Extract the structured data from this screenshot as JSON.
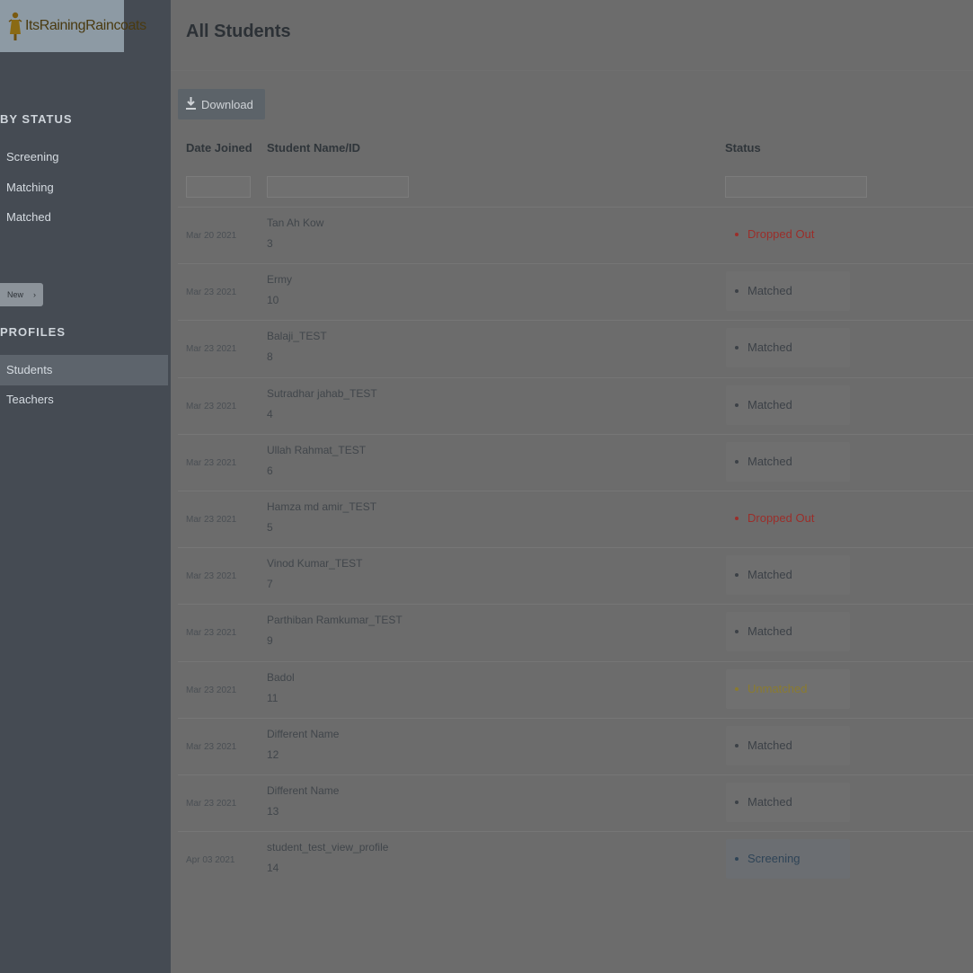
{
  "sidebar": {
    "logo_text": "ItsRainingRaincoats",
    "by_status_title": "BY STATUS",
    "status_links": [
      "Screening",
      "Matching",
      "Matched"
    ],
    "new_badge": "New",
    "profiles_title": "PROFILES",
    "profile_links": [
      "Students",
      "Teachers"
    ],
    "active_profile": "Students"
  },
  "main": {
    "title": "All Students",
    "download_label": "Download",
    "columns": [
      "Date Joined",
      "Student Name/ID",
      "Status"
    ],
    "rows": [
      {
        "date": "Mar 20 2021",
        "name": "Tan Ah Kow",
        "id": "3",
        "status": "Dropped Out",
        "kind": "dropped"
      },
      {
        "date": "Mar 23 2021",
        "name": "Ermy",
        "id": "10",
        "status": "Matched",
        "kind": "matched"
      },
      {
        "date": "Mar 23 2021",
        "name": "Balaji_TEST",
        "id": "8",
        "status": "Matched",
        "kind": "matched"
      },
      {
        "date": "Mar 23 2021",
        "name": "Sutradhar jahab_TEST",
        "id": "4",
        "status": "Matched",
        "kind": "matched"
      },
      {
        "date": "Mar 23 2021",
        "name": "Ullah Rahmat_TEST",
        "id": "6",
        "status": "Matched",
        "kind": "matched"
      },
      {
        "date": "Mar 23 2021",
        "name": "Hamza md amir_TEST",
        "id": "5",
        "status": "Dropped Out",
        "kind": "dropped"
      },
      {
        "date": "Mar 23 2021",
        "name": "Vinod Kumar_TEST",
        "id": "7",
        "status": "Matched",
        "kind": "matched"
      },
      {
        "date": "Mar 23 2021",
        "name": "Parthiban Ramkumar_TEST",
        "id": "9",
        "status": "Matched",
        "kind": "matched"
      },
      {
        "date": "Mar 23 2021",
        "name": "Badol",
        "id": "11",
        "status": "Unmatched",
        "kind": "unmatched"
      },
      {
        "date": "Mar 23 2021",
        "name": "Different Name",
        "id": "12",
        "status": "Matched",
        "kind": "matched"
      },
      {
        "date": "Mar 23 2021",
        "name": "Different Name",
        "id": "13",
        "status": "Matched",
        "kind": "matched"
      },
      {
        "date": "Apr 03 2021",
        "name": "student_test_view_profile",
        "id": "14",
        "status": "Screening",
        "kind": "screening"
      }
    ]
  },
  "colors": {
    "dropped": "#9b2e2a",
    "matched": "#3c4147",
    "unmatched": "#8a7b2f",
    "screening": "#2f4457"
  },
  "icons": {
    "logo": "raincoat-figure-icon",
    "download": "download-icon",
    "new_badge_arrow": "chevron-right-icon"
  }
}
